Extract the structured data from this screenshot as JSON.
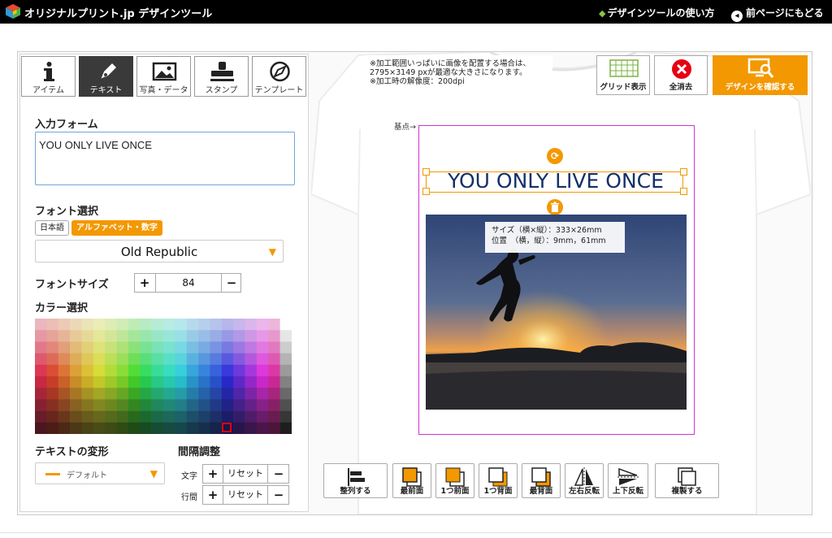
{
  "header": {
    "logo_text": "オリジナルプリント.jp デザインツール",
    "guide_link": "デザインツールの使い方",
    "back_link": "前ページにもどる"
  },
  "tabs": [
    {
      "label": "アイテム",
      "icon": "info-icon",
      "active": false
    },
    {
      "label": "テキスト",
      "icon": "pen-icon",
      "active": true
    },
    {
      "label": "写真・データ",
      "icon": "image-icon",
      "active": false
    },
    {
      "label": "スタンプ",
      "icon": "stamp-icon",
      "active": false
    },
    {
      "label": "テンプレート",
      "icon": "compass-icon",
      "active": false
    }
  ],
  "text_panel": {
    "input_label": "入力フォーム",
    "input_value": "YOU ONLY LIVE ONCE",
    "font_label": "フォント選択",
    "font_tabs": [
      "日本語",
      "アルファベット・数字"
    ],
    "font_value": "Old Republic",
    "size_label": "フォントサイズ",
    "size_value": "84",
    "color_label": "カラー選択",
    "deform_label": "テキストの変形",
    "deform_value": "デフォルト",
    "spacing_label": "間隔調整",
    "char_label": "文字",
    "line_label": "行間",
    "reset_label": "リセット",
    "plus": "+",
    "minus": "−"
  },
  "canvas": {
    "note_lines": [
      "※加工範囲いっぱいに画像を配置する場合は、",
      "2795×3149 pxが最適な大きさになります。",
      "※加工時の解像度：200dpi"
    ],
    "origin_label": "基点→",
    "design_text": "YOU ONLY LIVE ONCE",
    "info_size": "サイズ（横×縦）：333×26mm",
    "info_pos": "位置　（横，縦）：9mm，61mm"
  },
  "toolbar_top": {
    "grid": "グリッド表示",
    "clear": "全消去",
    "confirm": "デザインを確認する"
  },
  "toolbar_bottom": [
    "整列する",
    "最前面",
    "1つ前面",
    "1つ背面",
    "最背面",
    "左右反転",
    "上下反転",
    "複製する"
  ],
  "colors": {
    "accent": "#f39800",
    "print_area": "#d233d2",
    "text_color": "#143069",
    "clear_red": "#e60012"
  }
}
